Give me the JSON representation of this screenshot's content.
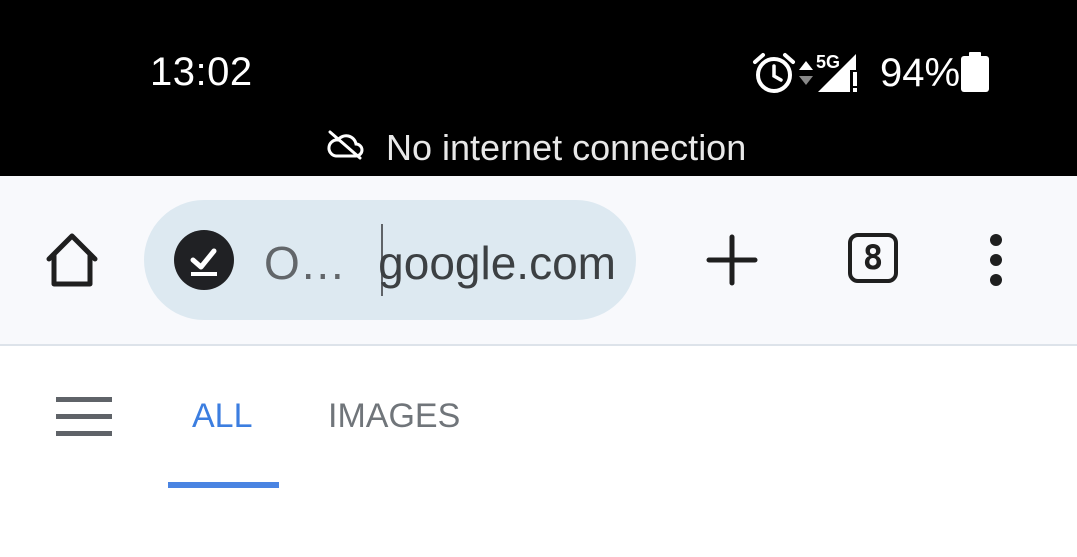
{
  "status_bar": {
    "time": "13:02",
    "network": "5G",
    "battery_percent": "94%",
    "offline_message": "No internet connection"
  },
  "toolbar": {
    "page_title": "O…",
    "url_domain": "google.com",
    "tab_count": "8",
    "icons": [
      "home-icon",
      "offline-page-icon",
      "new-tab-icon",
      "tab-switcher-icon",
      "more-options-icon"
    ]
  },
  "search_nav": {
    "tabs": [
      {
        "label": "ALL",
        "active": true
      },
      {
        "label": "IMAGES",
        "active": false
      }
    ],
    "accent_color": "#4a84e2"
  }
}
